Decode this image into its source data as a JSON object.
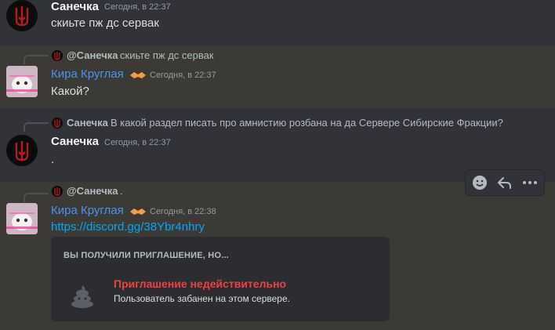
{
  "messages": {
    "m1": {
      "author": "Санечка",
      "timestamp": "Сегодня, в 22:37",
      "text": "скиьте пж дс сервак"
    },
    "m2": {
      "reply_author": "@Санечка",
      "reply_text": "скиьте пж дс сервак",
      "author": "Кира Круглая",
      "timestamp": "Сегодня, в 22:37",
      "text": "Какой?"
    },
    "m3": {
      "reply_author": "Санечка",
      "reply_text": "В какой раздел писать про амнистию розбана на да Сервере Сибирские Фракции?",
      "author": "Санечка",
      "timestamp": "Сегодня, в 22:37",
      "text": "."
    },
    "m4": {
      "reply_author": "@Санечка",
      "reply_text": ".",
      "author": "Кира Круглая",
      "timestamp": "Сегодня, в 22:38",
      "link": "https://discord.gg/38Ybr4nhry"
    }
  },
  "invite": {
    "header": "ВЫ ПОЛУЧИЛИ ПРИГЛАШЕНИЕ, НО...",
    "title": "Приглашение недействительно",
    "subtitle": "Пользователь забанен на этом сервере.",
    "icon": "poop-icon"
  },
  "toolbar": {
    "icons": [
      "add-reaction-icon",
      "reply-icon",
      "more-icon"
    ]
  },
  "colors": {
    "background": "#313338",
    "mention_highlight": "#3b3a35",
    "username_blue": "#4b93f0",
    "link": "#00a8fc",
    "invalid_red": "#f23f43"
  }
}
